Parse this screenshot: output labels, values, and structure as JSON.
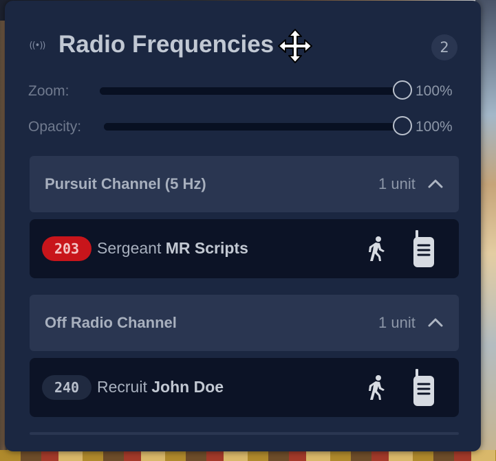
{
  "panel": {
    "title": "Radio Frequencies",
    "count": "2",
    "icons": {
      "radio": "radio-waves-icon",
      "move": "move-arrows-icon"
    }
  },
  "sliders": {
    "zoom": {
      "label": "Zoom:",
      "value": "100%",
      "level": 1.0
    },
    "opacity": {
      "label": "Opacity:",
      "value": "100%",
      "level": 1.0
    }
  },
  "channels": [
    {
      "name": "Pursuit Channel (5 Hz)",
      "count": "1 unit",
      "units": [
        {
          "callsign": "203",
          "callsign_color": "#c8151b",
          "rank": "Sergeant",
          "name": "MR Scripts",
          "status_icon": "walking-icon",
          "radio_icon": "walkie-talkie-icon"
        }
      ]
    },
    {
      "name": "Off Radio Channel",
      "count": "1 unit",
      "units": [
        {
          "callsign": "240",
          "callsign_color": "#202a40",
          "rank": "Recruit",
          "name": "John Doe",
          "status_icon": "walking-icon",
          "radio_icon": "walkie-talkie-icon"
        }
      ]
    }
  ]
}
